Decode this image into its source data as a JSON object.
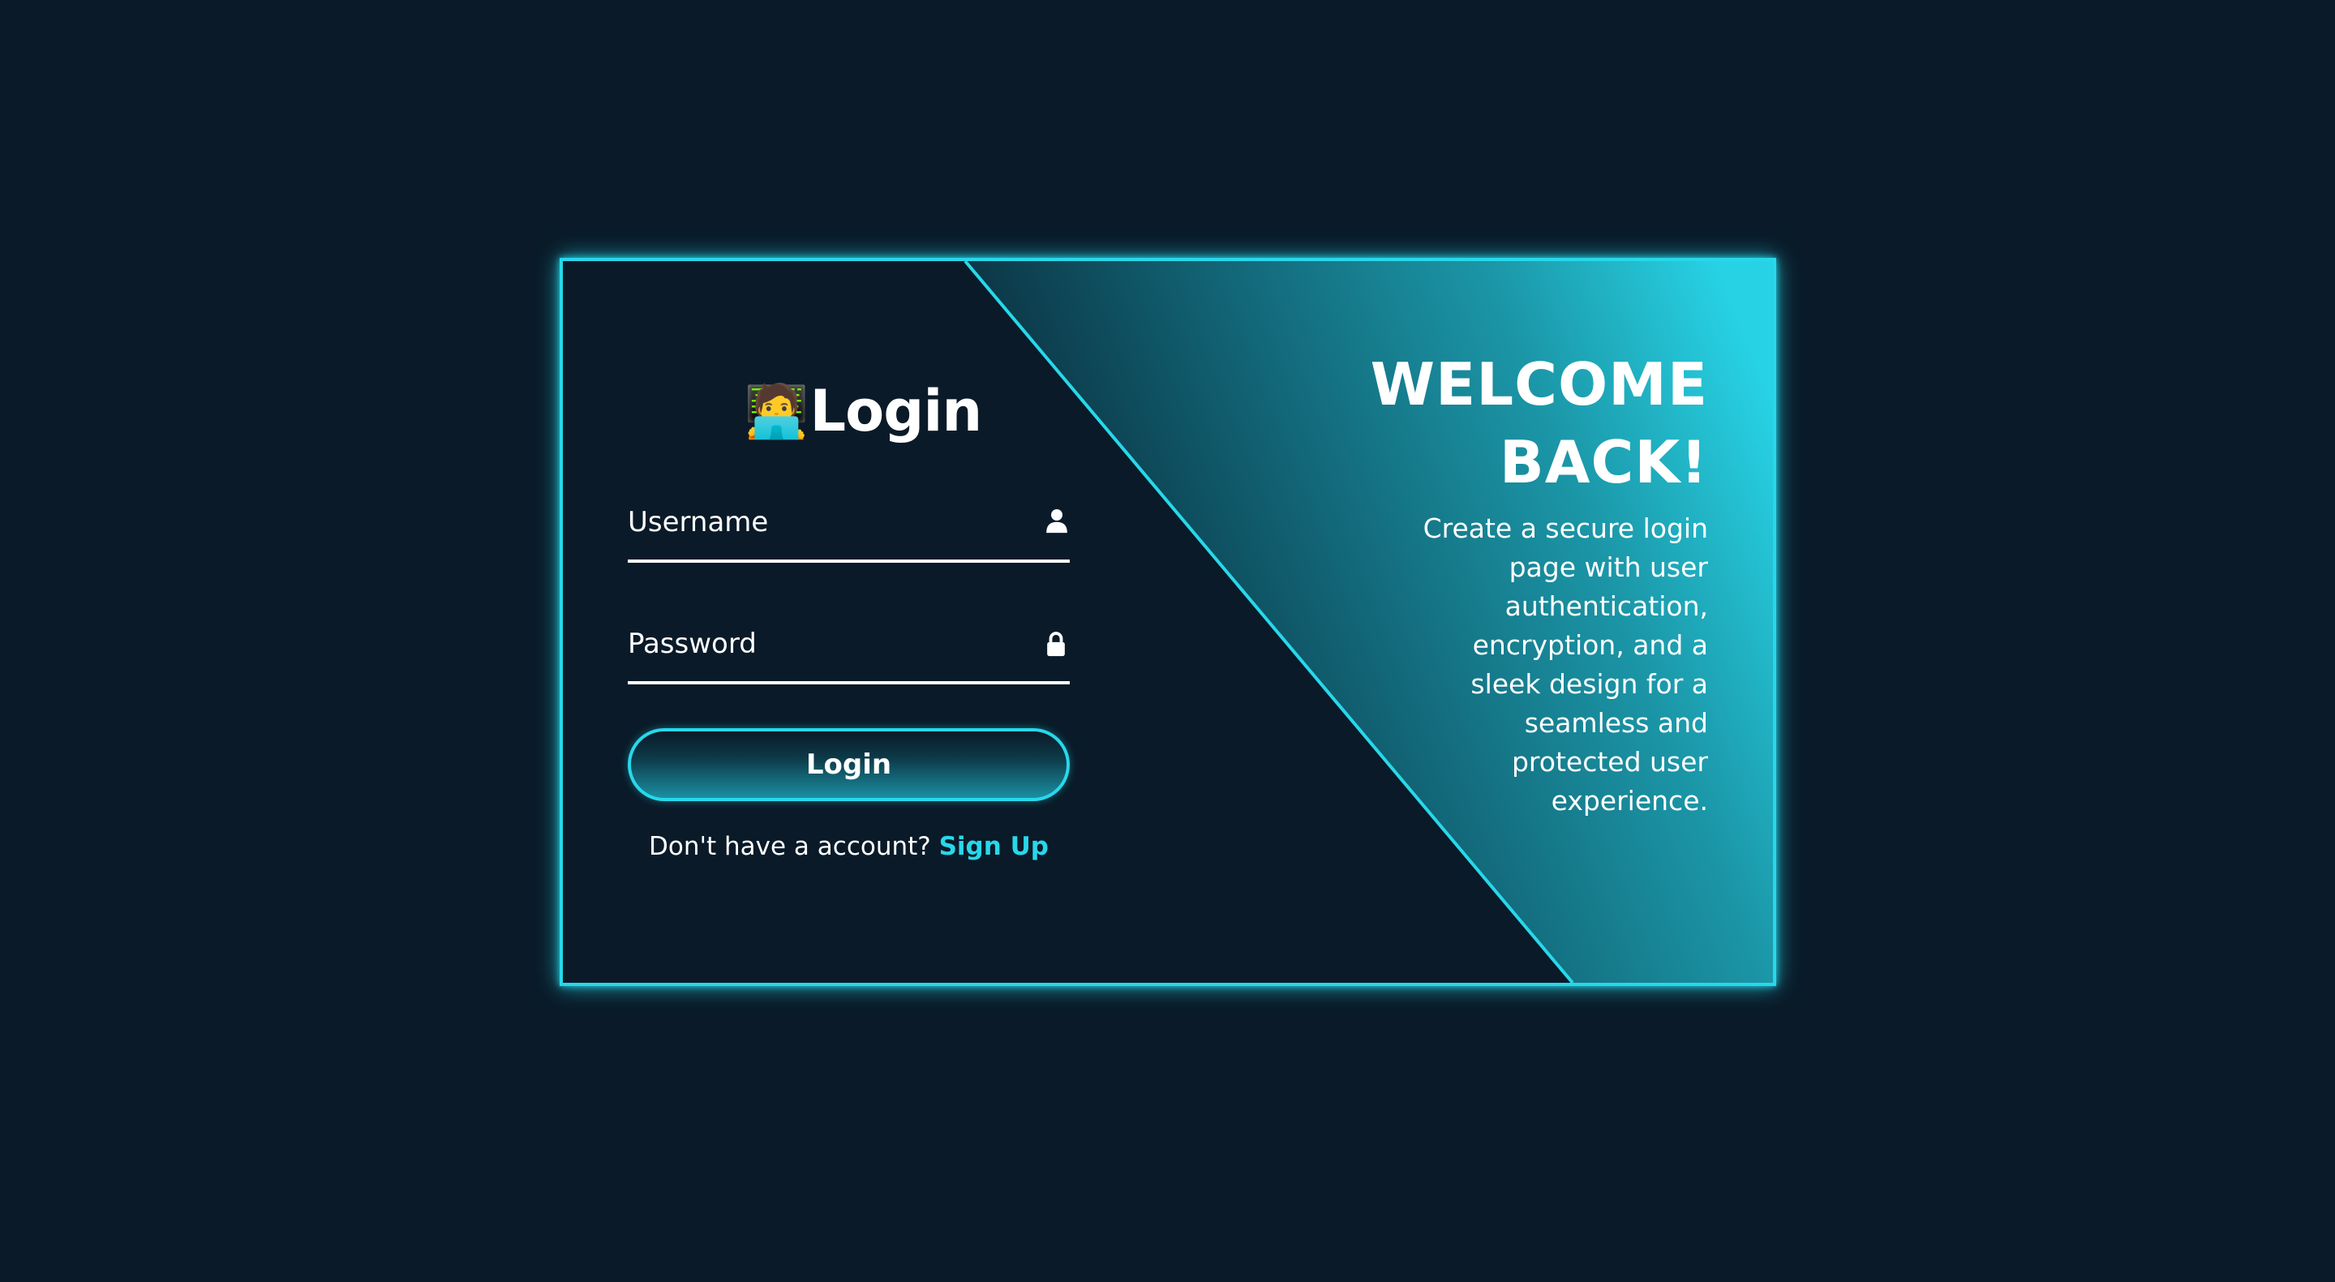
{
  "form": {
    "title": "Login",
    "title_emoji": "🧑‍💻",
    "username_label": "Username",
    "password_label": "Password",
    "username_icon": "user-icon",
    "password_icon": "lock-icon",
    "login_button": "Login",
    "signup_prompt": "Don't have a account?",
    "signup_link": "Sign Up"
  },
  "welcome": {
    "title_line1": "WELCOME",
    "title_line2": "BACK!",
    "text_lines": [
      "Create a secure login",
      "page with user",
      "authentication,",
      "encryption, and a",
      "sleek design for a",
      "seamless and",
      "protected user",
      "experience."
    ]
  },
  "colors": {
    "background": "#0a1a28",
    "accent": "#27d8ea",
    "text": "#ffffff"
  }
}
